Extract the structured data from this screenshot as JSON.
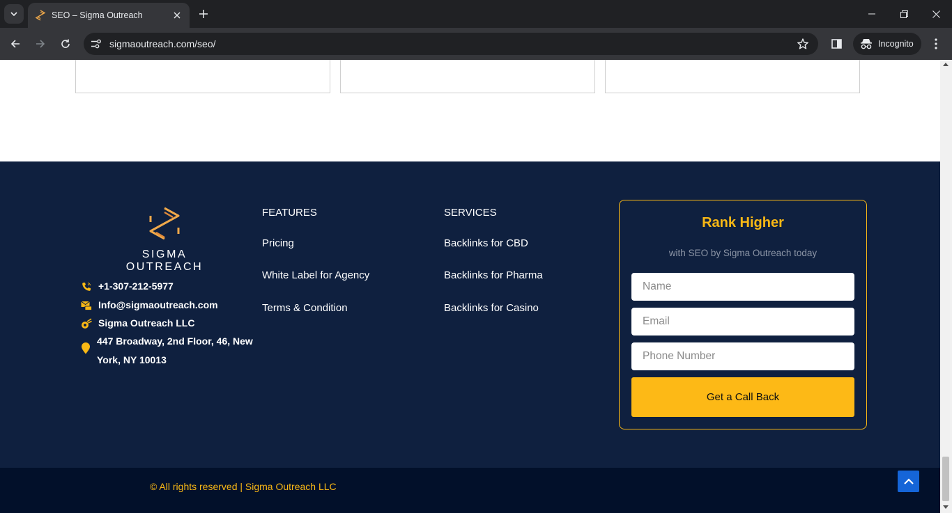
{
  "browser": {
    "tab_title": "SEO – Sigma Outreach",
    "url": "sigmaoutreach.com/seo/",
    "incognito_label": "Incognito",
    "icons": [
      "tab-list-icon",
      "close-icon",
      "plus-icon",
      "minimize-icon",
      "restore-icon",
      "window-close-icon",
      "back-icon",
      "forward-icon",
      "reload-icon",
      "site-info-icon",
      "star-icon",
      "side-panel-icon",
      "incognito-icon",
      "more-menu-icon"
    ]
  },
  "brand": {
    "name": "SIGMA OUTREACH",
    "accent": "#f9b815",
    "footer_bg": "#0f203f",
    "bottom_bg": "#02102a"
  },
  "contact": {
    "phone": "+1-307-212-5977",
    "email": "Info@sigmaoutreach.com",
    "company": "Sigma Outreach LLC",
    "address": "447 Broadway, 2nd Floor, 46, New York, NY 10013"
  },
  "features": {
    "heading": "FEATURES",
    "links": [
      "Pricing",
      "White Label for Agency",
      "Terms & Condition"
    ]
  },
  "services": {
    "heading": "SERVICES",
    "links": [
      "Backlinks for CBD",
      "Backlinks for Pharma",
      "Backlinks for Casino"
    ]
  },
  "form": {
    "title": "Rank Higher",
    "subtitle": "with SEO by Sigma Outreach today",
    "name_placeholder": "Name",
    "email_placeholder": "Email",
    "phone_placeholder": "Phone Number",
    "button_label": "Get a Call Back"
  },
  "footer": {
    "copyright": "© All rights reserved | Sigma Outreach LLC"
  }
}
